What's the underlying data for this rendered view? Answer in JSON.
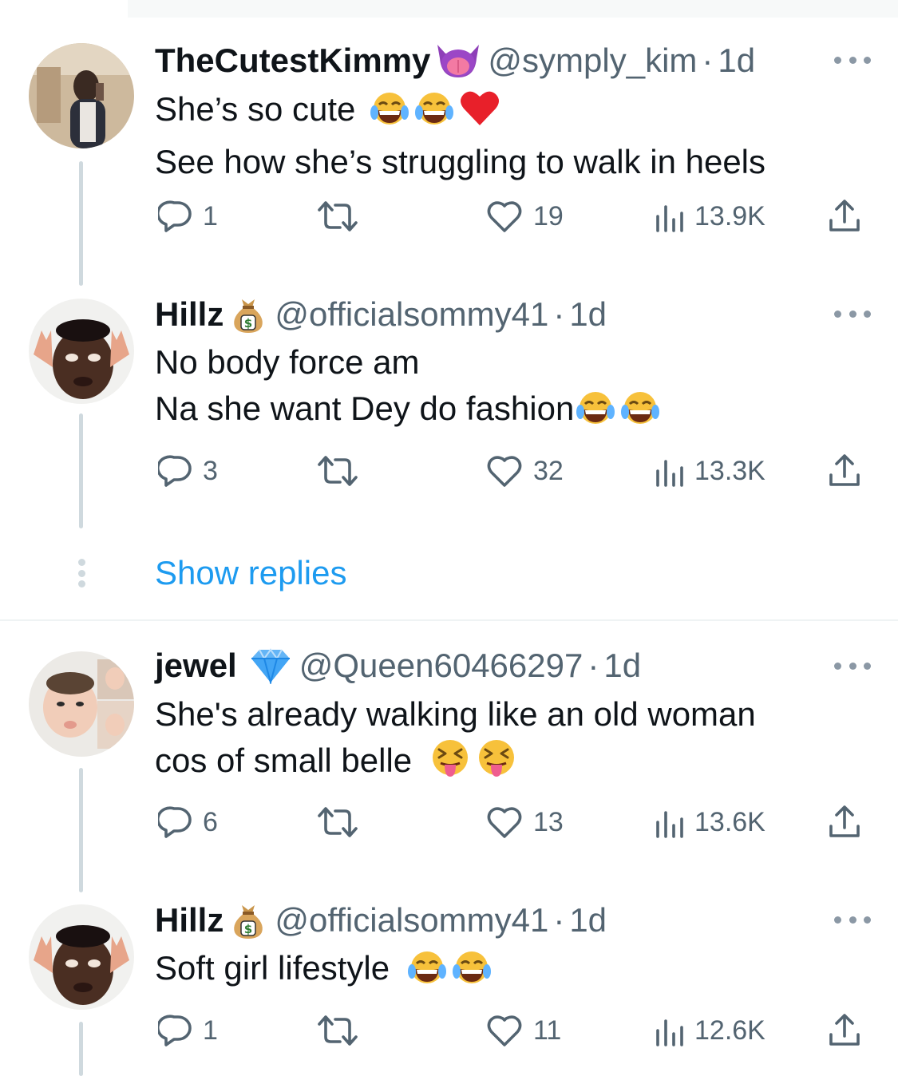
{
  "tweets": [
    {
      "name": "TheCutestKimmy",
      "badge": "tongue-face-emoji",
      "handle": "@symply_kim",
      "dot": "·",
      "time": "1d",
      "lines": [
        "She’s so cute",
        "See how she’s struggling to walk in heels"
      ],
      "replies": "1",
      "likes": "19",
      "views": "13.9K"
    },
    {
      "name": "Hillz",
      "badge": "money-bag-emoji",
      "handle": "@officialsommy41",
      "dot": "·",
      "time": "1d",
      "lines": [
        "No body force am",
        "Na she want Dey do fashion"
      ],
      "replies": "3",
      "likes": "32",
      "views": "13.3K"
    },
    {
      "name": "jewel",
      "badge": "gem-emoji",
      "handle": "@Queen60466297",
      "dot": "·",
      "time": "1d",
      "lines": [
        "She's already walking like an old woman",
        "cos of small belle"
      ],
      "replies": "6",
      "likes": "13",
      "views": "13.6K"
    },
    {
      "name": "Hillz",
      "badge": "money-bag-emoji",
      "handle": "@officialsommy41",
      "dot": "·",
      "time": "1d",
      "lines": [
        "Soft girl lifestyle"
      ],
      "replies": "1",
      "likes": "11",
      "views": "12.6K"
    }
  ],
  "show_replies": "Show replies",
  "colors": {
    "text": "#0f1419",
    "secondary": "#536471",
    "link": "#1d9bf0",
    "thread_line": "#cfd9de"
  }
}
